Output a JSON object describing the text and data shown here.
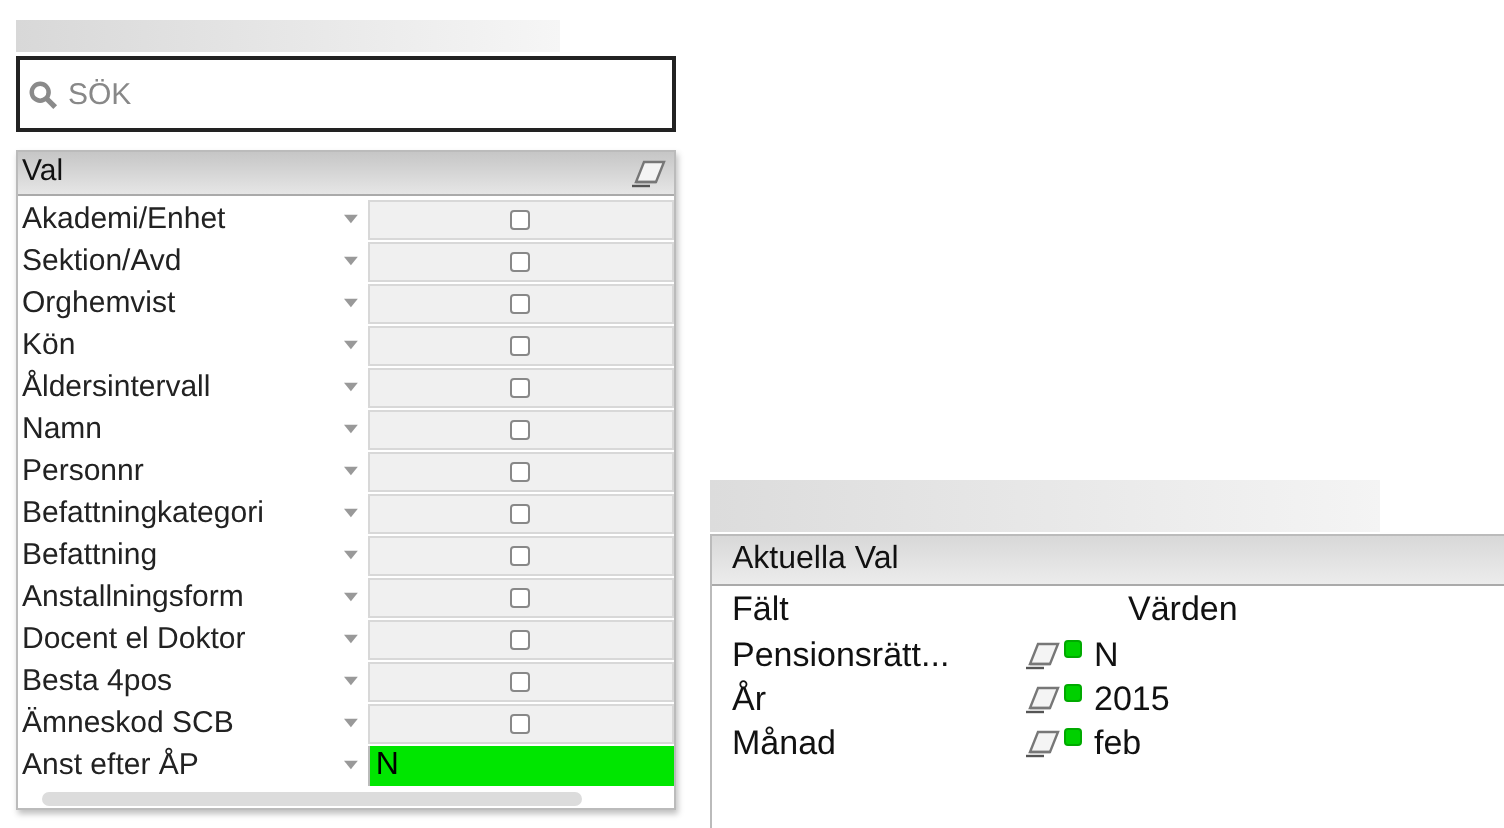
{
  "search": {
    "placeholder": "SÖK"
  },
  "list_box": {
    "title": "Val",
    "rows": [
      {
        "label": "Akademi/Enhet",
        "selected": false
      },
      {
        "label": "Sektion/Avd",
        "selected": false
      },
      {
        "label": "Orghemvist",
        "selected": false
      },
      {
        "label": "Kön",
        "selected": false
      },
      {
        "label": "Åldersintervall",
        "selected": false
      },
      {
        "label": "Namn",
        "selected": false
      },
      {
        "label": "Personnr",
        "selected": false
      },
      {
        "label": "Befattningkategori",
        "selected": false
      },
      {
        "label": "Befattning",
        "selected": false
      },
      {
        "label": "Anstallningsform",
        "selected": false
      },
      {
        "label": "Docent el Doktor",
        "selected": false
      },
      {
        "label": "Besta 4pos",
        "selected": false
      },
      {
        "label": "Ämneskod SCB",
        "selected": false
      },
      {
        "label": "Anst efter ÅP",
        "selected": true,
        "value": "N"
      }
    ]
  },
  "current_selections": {
    "title": "Aktuella Val",
    "columns": [
      "Fält",
      "Värden"
    ],
    "rows": [
      {
        "field": "Pensionsrätt...",
        "value": "N"
      },
      {
        "field": "År",
        "value": "2015"
      },
      {
        "field": "Månad",
        "value": "feb"
      }
    ]
  }
}
